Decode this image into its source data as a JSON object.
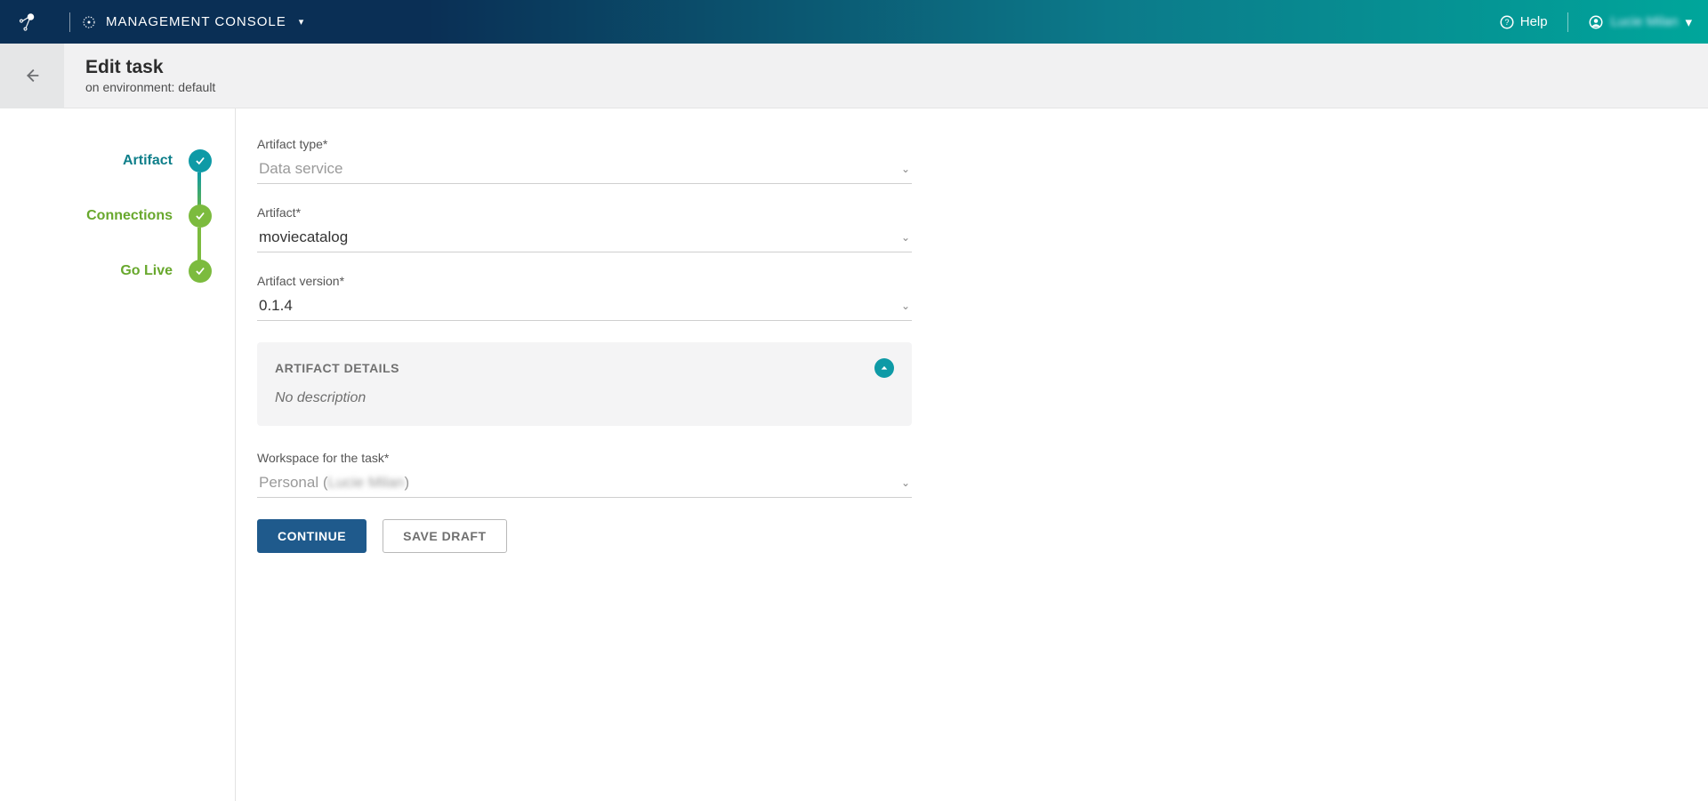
{
  "topbar": {
    "title": "MANAGEMENT CONSOLE",
    "help_label": "Help",
    "user_name": "Lucie Milan"
  },
  "subheader": {
    "title": "Edit task",
    "environment": "on environment: default"
  },
  "steps": {
    "artifact": "Artifact",
    "connections": "Connections",
    "golive": "Go Live"
  },
  "form": {
    "artifact_type_label": "Artifact type*",
    "artifact_type_value": "Data service",
    "artifact_label": "Artifact*",
    "artifact_value": "moviecatalog",
    "artifact_version_label": "Artifact version*",
    "artifact_version_value": "0.1.4",
    "details_title": "ARTIFACT DETAILS",
    "details_description": "No description",
    "workspace_label": "Workspace for the task*",
    "workspace_prefix": "Personal (",
    "workspace_user": "Lucie Milan",
    "workspace_suffix": ")",
    "continue": "CONTINUE",
    "save_draft": "SAVE DRAFT"
  }
}
